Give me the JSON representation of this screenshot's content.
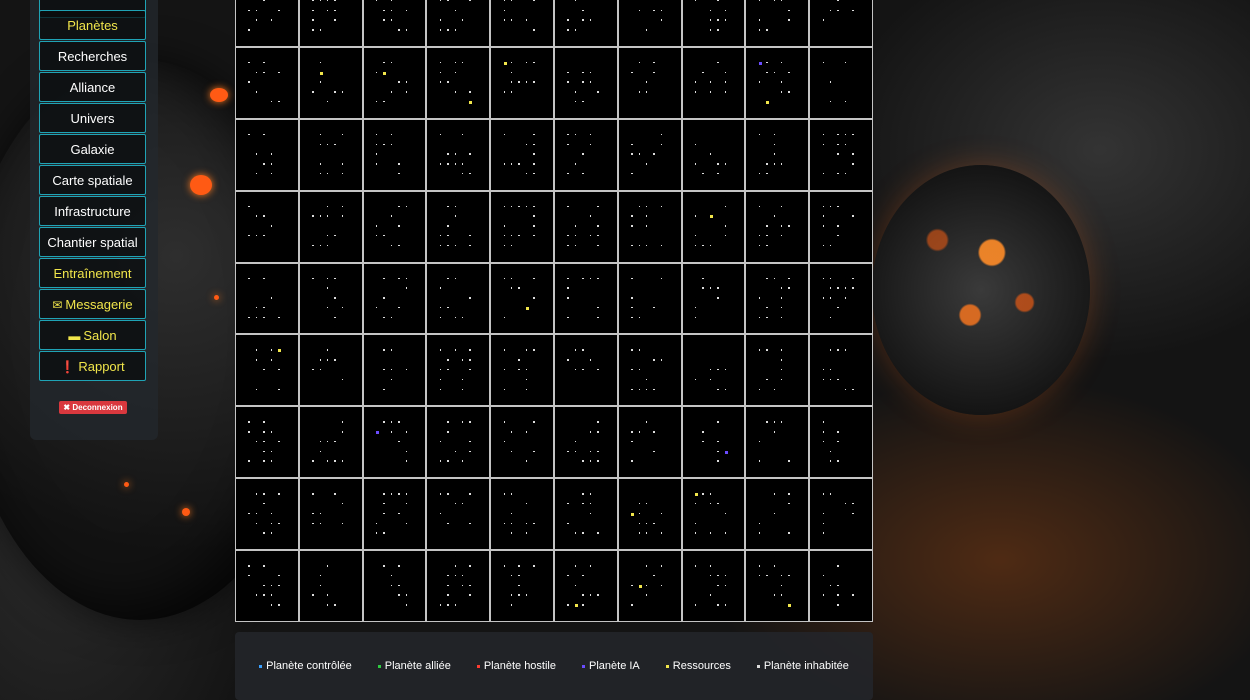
{
  "sidebar": {
    "items": [
      {
        "label": "",
        "color": "yellow"
      },
      {
        "label": "Planètes",
        "color": "yellow"
      },
      {
        "label": "Recherches",
        "color": "white"
      },
      {
        "label": "Alliance",
        "color": "white"
      },
      {
        "label": "Univers",
        "color": "white"
      },
      {
        "label": "Galaxie",
        "color": "white"
      },
      {
        "label": "Carte spatiale",
        "color": "white"
      },
      {
        "label": "Infrastructure",
        "color": "white"
      },
      {
        "label": "Chantier spatial",
        "color": "white"
      },
      {
        "label": "Entraînement",
        "color": "yellow"
      },
      {
        "label": "Messagerie",
        "color": "yellow",
        "icon": "envelope-icon"
      },
      {
        "label": "Salon",
        "color": "yellow",
        "icon": "chat-bubble-icon"
      },
      {
        "label": "Rapport",
        "color": "yellow",
        "icon": "exclamation-circle-icon"
      }
    ],
    "logout_label": "Deconnexion"
  },
  "map": {
    "columns": 10,
    "rows": 9,
    "highlights": [
      {
        "row": 1,
        "col": 1,
        "color": "yellow"
      },
      {
        "row": 1,
        "col": 2,
        "color": "yellow"
      },
      {
        "row": 1,
        "col": 3,
        "color": "yellow"
      },
      {
        "row": 1,
        "col": 4,
        "color": "yellow"
      },
      {
        "row": 1,
        "col": 8,
        "color": "yellow"
      },
      {
        "row": 3,
        "col": 7,
        "color": "yellow"
      },
      {
        "row": 4,
        "col": 4,
        "color": "yellow"
      },
      {
        "row": 5,
        "col": 0,
        "color": "yellow"
      },
      {
        "row": 7,
        "col": 6,
        "color": "yellow"
      },
      {
        "row": 7,
        "col": 7,
        "color": "yellow"
      },
      {
        "row": 8,
        "col": 5,
        "color": "yellow"
      },
      {
        "row": 8,
        "col": 6,
        "color": "yellow"
      },
      {
        "row": 8,
        "col": 8,
        "color": "yellow"
      },
      {
        "row": 1,
        "col": 8,
        "color": "purple"
      },
      {
        "row": 6,
        "col": 2,
        "color": "purple"
      },
      {
        "row": 6,
        "col": 7,
        "color": "purple"
      }
    ]
  },
  "legend": [
    {
      "label": "Planète contrôlée",
      "color": "#3aa0ff"
    },
    {
      "label": "Planète alliée",
      "color": "#2ecc40"
    },
    {
      "label": "Planète hostile",
      "color": "#ff3b30"
    },
    {
      "label": "Planète IA",
      "color": "#6a4cff"
    },
    {
      "label": "Ressources",
      "color": "#f1e64b"
    },
    {
      "label": "Planète inhabitée",
      "color": "#dcdcdc"
    }
  ],
  "colors": {
    "accent": "#1fa3b5",
    "highlight_text": "#f1e64b",
    "logout": "#d9383e",
    "grid_line": "#c4c4c4"
  }
}
